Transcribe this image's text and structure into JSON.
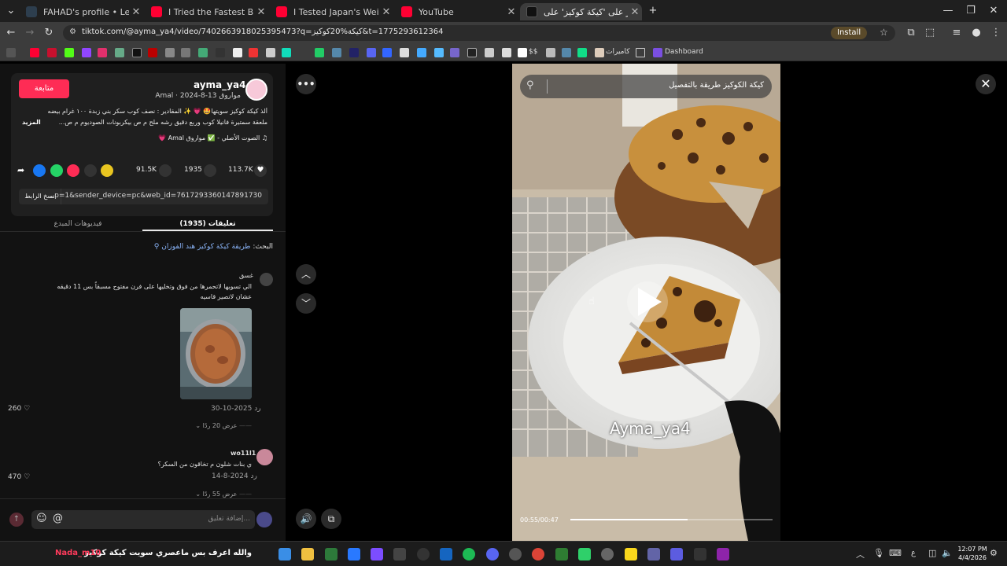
{
  "colors": {
    "accent": "#fe2c55",
    "chrome_bg": "#3c3c3c",
    "tab_bg": "#1f1f1f",
    "page_bg": "#121212",
    "link_blue": "#8ab4f8"
  },
  "tabs": [
    {
      "title": "FAHAD's profile • Letterboxd",
      "icon": "letterboxd-icon"
    },
    {
      "title": "I Tried the Fastest Bullet Train in",
      "icon": "youtube-icon"
    },
    {
      "title": "I Tested Japan's Weirdest Trains",
      "icon": "youtube-icon"
    },
    {
      "title": "YouTube",
      "icon": "youtube-icon"
    },
    {
      "title": "اعثر على 'كيكة كوكيز' على :k",
      "icon": "tiktok-icon"
    }
  ],
  "toolbar": {
    "url": "tiktok.com/@ayma_ya4/video/7402663918025395473?q=كيكة%20كوكيز&t=1775293612364",
    "install_label": "Install"
  },
  "bookmarks": {
    "folder1": "كاميرات",
    "dashboard": "Dashboard",
    "dollar": "$$"
  },
  "post": {
    "follow_label": "متابعة",
    "username": "ayma_ya4",
    "display_name": "مواروق Amal",
    "date": "2024-8-13",
    "caption_line1": "ألذ كيكة كوكيز سويتها🤩 💗 ✨ المقادير : نصف كوب سكر بني زبدة ١٠٠ غرام بيضه",
    "caption_line2": "ملعقة سمتيرة فانيلا كوب وربع دقيق رشه ملح م ص بيكربونات الصوديوم م ص...",
    "more_label": "المزيد",
    "sound": "الصوت الأصلي - ✅ مواروق Amal 💗",
    "likes": "113.7K",
    "comments": "1935",
    "saves": "91.5K",
    "link": "...p=1&sender_device=pc&web_id=7617293360147891730",
    "copy_label": "نسخ الرابط",
    "tab_comments": "تعليقات (1935)",
    "tab_creator": "فيديوهات المبدع",
    "search_hint_prefix": "البحث:",
    "search_hint_query": "طريقة كيكة كوكيز هند الفوزان"
  },
  "comments": [
    {
      "user": "غسق",
      "text": "الي تسويها لاتحمرها من فوق وتخليها على فرن مفتوح مسبقاً بس 11 دقيقه عشان لاتصير قاسيه",
      "date": "2025-10-30",
      "reply_label": "رد",
      "likes": "260",
      "view_replies": "عرض 20 ردًا"
    },
    {
      "user": "wo11l1",
      "text": "ي بنات شلون م تخاقون من السكر؟",
      "date": "2024-8-14",
      "reply_label": "رد",
      "likes": "470",
      "view_replies": "عرض 55 ردًا"
    }
  ],
  "comment_input": {
    "placeholder": "إضافة تعليق..."
  },
  "video": {
    "search_query": "كيكة الكوكيز طريقة بالتفصيل",
    "watermark": "Ayma_ya4",
    "time": "00:55/00:47",
    "progress": 0.58
  },
  "taskbar": {
    "song": "والله اعرف بس ماعصري سويت كيكة كوكيز",
    "user": "Nada_m10",
    "time": "12:07 PM",
    "date": "4/4/2026",
    "lang": "ع"
  }
}
